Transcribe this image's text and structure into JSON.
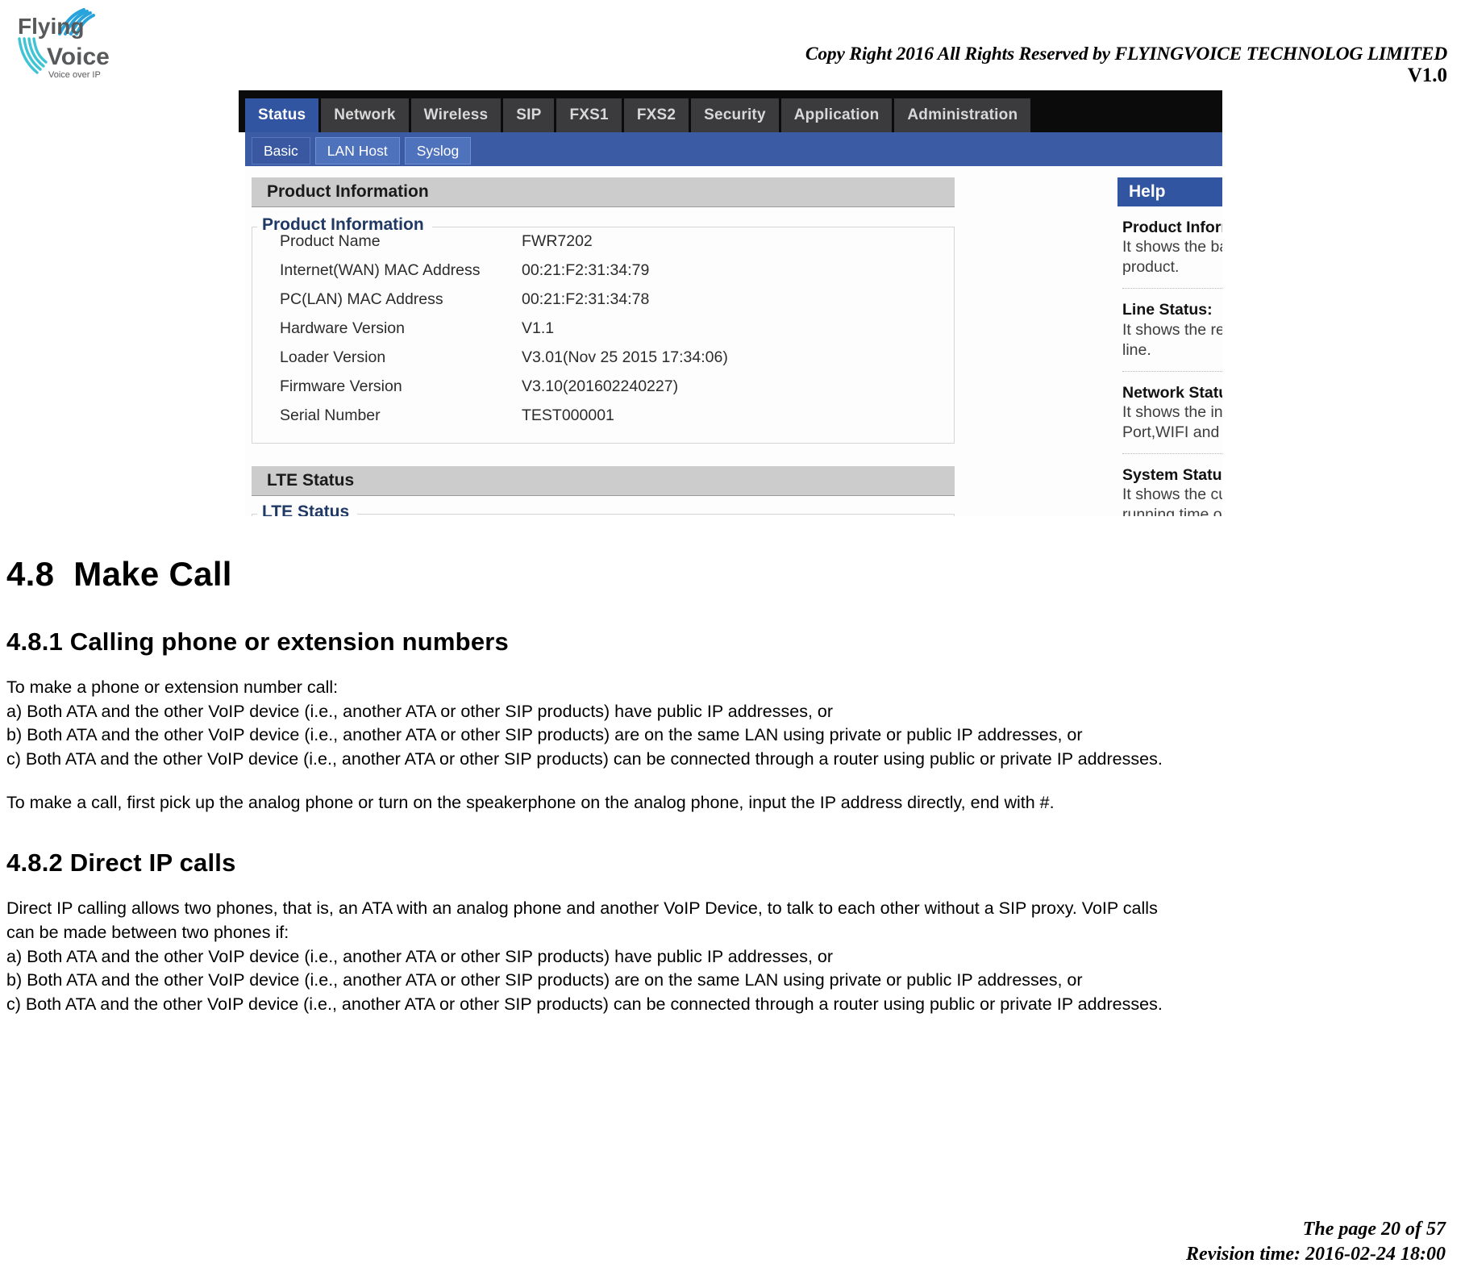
{
  "header": {
    "logo_primary": "Flying",
    "logo_secondary": "Voice",
    "logo_tagline": "Voice over IP",
    "copyright": "Copy Right 2016 All Rights Reserved by FLYINGVOICE TECHNOLOG LIMITED",
    "version": "V1.0"
  },
  "screenshot": {
    "nav_tabs": [
      {
        "label": "Status",
        "active": true
      },
      {
        "label": "Network",
        "active": false
      },
      {
        "label": "Wireless",
        "active": false
      },
      {
        "label": "SIP",
        "active": false
      },
      {
        "label": "FXS1",
        "active": false
      },
      {
        "label": "FXS2",
        "active": false
      },
      {
        "label": "Security",
        "active": false
      },
      {
        "label": "Application",
        "active": false
      },
      {
        "label": "Administration",
        "active": false
      }
    ],
    "sub_tabs": [
      {
        "label": "Basic",
        "active": true
      },
      {
        "label": "LAN Host",
        "active": false
      },
      {
        "label": "Syslog",
        "active": false
      }
    ],
    "product_section_title": "Product Information",
    "product_legend": "Product Information",
    "product_rows": [
      {
        "label": "Product Name",
        "value": "FWR7202"
      },
      {
        "label": "Internet(WAN) MAC Address",
        "value": "00:21:F2:31:34:79"
      },
      {
        "label": "PC(LAN) MAC Address",
        "value": "00:21:F2:31:34:78"
      },
      {
        "label": "Hardware Version",
        "value": "V1.1"
      },
      {
        "label": "Loader Version",
        "value": "V3.01(Nov 25 2015 17:34:06)"
      },
      {
        "label": "Firmware Version",
        "value": "V3.10(201602240227)"
      },
      {
        "label": "Serial Number",
        "value": "TEST000001"
      }
    ],
    "lte_section_title": "LTE Status",
    "lte_legend": "LTE Status",
    "help": {
      "title": "Help",
      "blocks": [
        {
          "heading": "Product Inform",
          "lines": [
            "It shows the bas",
            "product."
          ]
        },
        {
          "heading": "Line Status:",
          "lines": [
            "It shows the regi",
            "line."
          ]
        },
        {
          "heading": "Network Statu",
          "lines": [
            "It shows the info",
            "Port,WIFI and PC"
          ]
        },
        {
          "heading": "System Status:",
          "lines": [
            "It shows the cur",
            "running time of "
          ]
        }
      ]
    }
  },
  "document": {
    "h1_number": "4.8",
    "h1_title": "Make Call",
    "s1_heading": "4.8.1 Calling phone or extension numbers",
    "s1_intro": "To make a phone or extension number call:",
    "s1_a": "a) Both ATA and the other VoIP device (i.e., another ATA or other SIP products) have public IP addresses, or",
    "s1_b": "b) Both ATA and the other VoIP device (i.e., another ATA or other SIP products) are on the same LAN using private or public IP addresses, or",
    "s1_c": "c) Both ATA and the other VoIP device (i.e., another ATA or other SIP products) can be connected through a router using public or private IP addresses.",
    "s1_note": "To make a call, first pick up the analog phone or turn on the speakerphone on the analog phone, input the IP address directly, end with #.",
    "s2_heading": "4.8.2 Direct IP calls",
    "s2_p1": "Direct IP calling allows two phones, that is, an ATA with an analog phone and another VoIP Device, to talk to each other without a SIP proxy. VoIP calls",
    "s2_p1b": "can be made between two phones if:",
    "s2_a": "a) Both ATA and the other VoIP device (i.e., another ATA or other SIP products) have public IP addresses, or",
    "s2_b": "b) Both ATA and the other VoIP device (i.e., another ATA or other SIP products) are on the same LAN using private or public IP addresses, or",
    "s2_c": "c) Both ATA and the other VoIP device (i.e., another ATA or other SIP products) can be connected through a router using public or private IP addresses."
  },
  "footer": {
    "page": "The page 20 of 57",
    "revision": "Revision time: 2016-02-24 18:00"
  }
}
